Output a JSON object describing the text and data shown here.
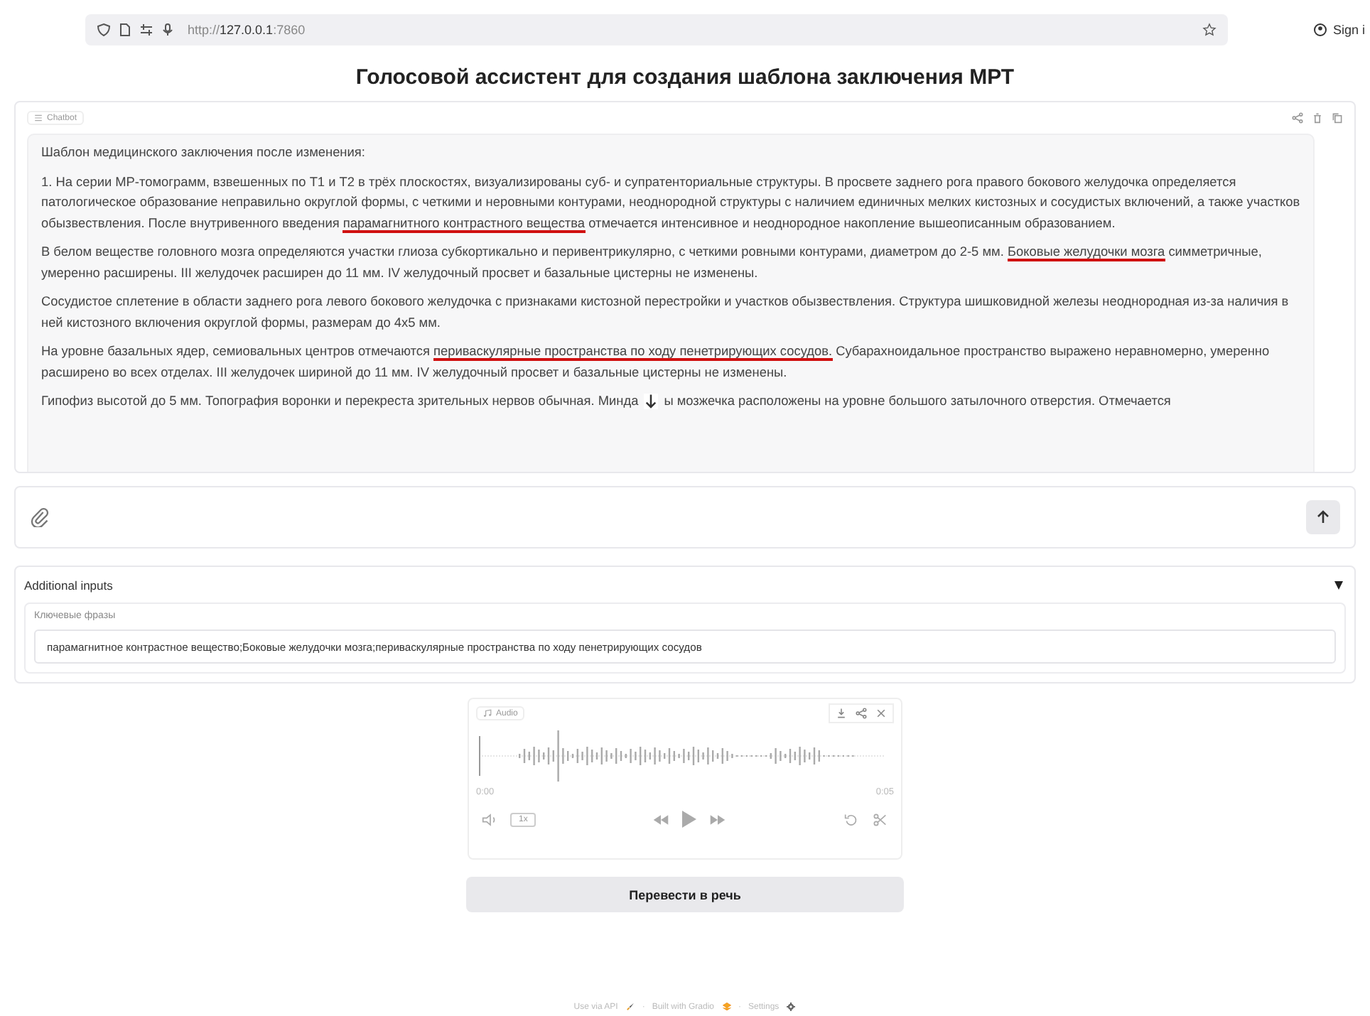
{
  "browser": {
    "url": "http://**127.0.0.1**:7860",
    "sign_in": "Sign i"
  },
  "title": "Голосовой ассистент для создания шаблона заключения МРТ",
  "chatbot": {
    "label": "Chatbot",
    "paragraphs": [
      {
        "segments": [
          {
            "kind": "text",
            "text": "Шаблон медицинского заключения после изменения:"
          }
        ]
      },
      {
        "segments": [
          {
            "kind": "text",
            "text": "1. На серии МР-томограмм, взвешенных по T1 и T2 в трёх плоскостях, визуализированы суб- и супратенториальные структуры. В просвете заднего рога правого бокового желудочка определяется патологическое образование неправильно округлой формы, с четкими и неровными контурами, неоднородной структуры с наличием единичных мелких кистозных и сосудистых включений, а также участков обызвествления. После внутривенного введения "
          },
          {
            "kind": "underlined",
            "text": "парамагнитного контрастного вещества"
          },
          {
            "kind": "text",
            "text": " отмечается интенсивное и неоднородное накопление вышеописанным образованием."
          }
        ]
      },
      {
        "segments": [
          {
            "kind": "text",
            "text": "В белом веществе головного мозга определяются участки глиоза субкортикально и перивентрикулярно, с четкими ровными контурами, диаметром до 2-5 мм. "
          },
          {
            "kind": "underlined",
            "text": "Боковые желудочки мозга"
          },
          {
            "kind": "text",
            "text": " симметричные, умеренно расширены. III желудочек расширен до 11 мм. IV желудочный просвет и базальные цистерны не изменены."
          }
        ]
      },
      {
        "segments": [
          {
            "kind": "text",
            "text": "Сосудистое сплетение в области заднего рога левого бокового желудочка с признаками кистозной перестройки и участков обызвествления. Структура шишковидной железы неоднородная из-за наличия в ней кистозного включения округлой формы, размерам до 4x5 мм."
          }
        ]
      },
      {
        "segments": [
          {
            "kind": "text",
            "text": "На уровне базальных ядер, семиовальных центров отмечаются "
          },
          {
            "kind": "underlined",
            "text": "периваскулярные пространства по ходу пенетрирующих сосудов."
          },
          {
            "kind": "text",
            "text": " Субарахноидальное пространство выражено неравномерно, умеренно расширено во всех отделах. III желудочек шириной до 11 мм. IV желудочный просвет и базальные цистерны не изменены."
          }
        ]
      },
      {
        "segments": [
          {
            "kind": "text",
            "text": "Гипофиз высотой до 5 мм. Топография воронки и перекреста зрительных нервов обычная. Минда"
          },
          {
            "kind": "scroll-button"
          },
          {
            "kind": "text",
            "text": "ы мозжечка расположены на уровне большого затылочного отверстия. Отмечается"
          }
        ]
      }
    ]
  },
  "additional_inputs": {
    "label": "Additional inputs",
    "expanded": true,
    "field_label": "Ключевые фразы",
    "value": "парамагнитное контрастное вещество;Боковые желудочки мозга;периваскулярные пространства по ходу пенетрирующих сосудов"
  },
  "audio": {
    "label": "Audio",
    "start_time": "0:00",
    "end_time": "0:05",
    "speed": "1x"
  },
  "convert_button": "Перевести в речь",
  "footer": {
    "api": "Use via API",
    "built": "Built with Gradio",
    "settings": "Settings",
    "separator": "·"
  }
}
